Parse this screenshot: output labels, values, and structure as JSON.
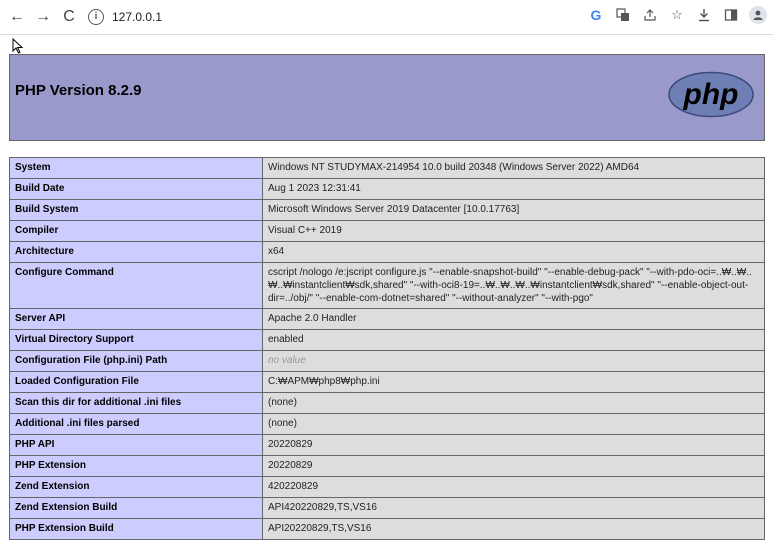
{
  "browser": {
    "url": "127.0.0.1",
    "back": "←",
    "forward": "→",
    "reload": "C"
  },
  "page": {
    "title": "PHP Version 8.2.9",
    "logo_text": "php",
    "rows": [
      {
        "key": "System",
        "value": "Windows NT STUDYMAX-214954 10.0 build 20348 (Windows Server 2022) AMD64"
      },
      {
        "key": "Build Date",
        "value": "Aug 1 2023 12:31:41"
      },
      {
        "key": "Build System",
        "value": "Microsoft Windows Server 2019 Datacenter [10.0.17763]"
      },
      {
        "key": "Compiler",
        "value": "Visual C++ 2019"
      },
      {
        "key": "Architecture",
        "value": "x64"
      },
      {
        "key": "Configure Command",
        "value": "cscript /nologo /e:jscript configure.js \"--enable-snapshot-build\" \"--enable-debug-pack\" \"--with-pdo-oci=..₩..₩..₩..₩instantclient₩sdk,shared\" \"--with-oci8-19=..₩..₩..₩..₩instantclient₩sdk,shared\" \"--enable-object-out-dir=../obj/\" \"--enable-com-dotnet=shared\" \"--without-analyzer\" \"--with-pgo\""
      },
      {
        "key": "Server API",
        "value": "Apache 2.0 Handler"
      },
      {
        "key": "Virtual Directory Support",
        "value": "enabled"
      },
      {
        "key": "Configuration File (php.ini) Path",
        "value": "no value"
      },
      {
        "key": "Loaded Configuration File",
        "value": "C:₩APM₩php8₩php.ini"
      },
      {
        "key": "Scan this dir for additional .ini files",
        "value": "(none)"
      },
      {
        "key": "Additional .ini files parsed",
        "value": "(none)"
      },
      {
        "key": "PHP API",
        "value": "20220829"
      },
      {
        "key": "PHP Extension",
        "value": "20220829"
      },
      {
        "key": "Zend Extension",
        "value": "420220829"
      },
      {
        "key": "Zend Extension Build",
        "value": "API420220829,TS,VS16"
      },
      {
        "key": "PHP Extension Build",
        "value": "API20220829,TS,VS16"
      }
    ]
  },
  "colors": {
    "header_bg": "#9999cc",
    "key_bg": "#ccccff",
    "value_bg": "#dddddd"
  }
}
